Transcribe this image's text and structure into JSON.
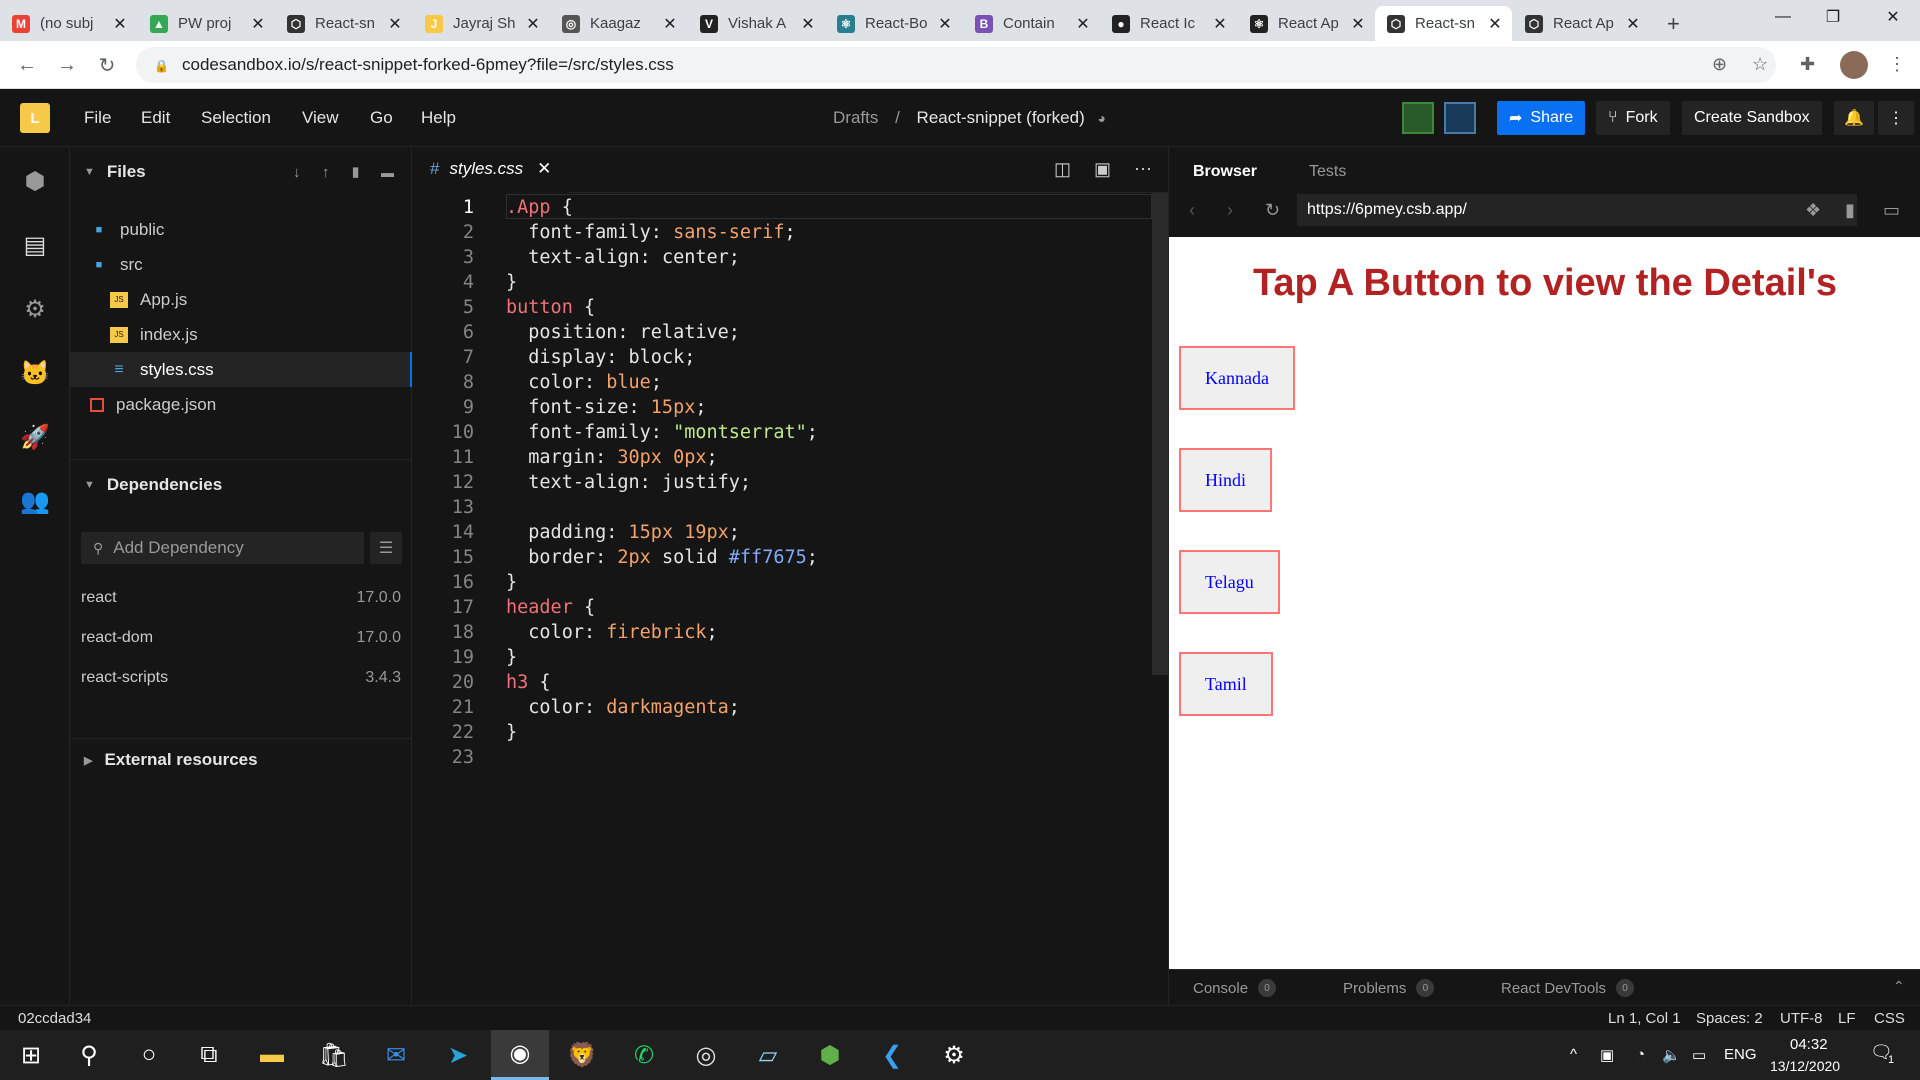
{
  "browser": {
    "tabs": [
      {
        "title": "(no subj",
        "icon": "gmail-icon",
        "color": "#ea4335",
        "glyph": "M"
      },
      {
        "title": "PW proj",
        "icon": "drive-icon",
        "color": "#34a853",
        "glyph": "▲"
      },
      {
        "title": "React-sn",
        "icon": "codesandbox-icon",
        "color": "#333333",
        "glyph": "⬡"
      },
      {
        "title": "Jayraj Sh",
        "icon": "j-icon",
        "color": "#f7c948",
        "glyph": "J"
      },
      {
        "title": "Kaagaz",
        "icon": "kaagaz-icon",
        "color": "#555555",
        "glyph": "◎"
      },
      {
        "title": "Vishak A",
        "icon": "v-icon",
        "color": "#222222",
        "glyph": "V"
      },
      {
        "title": "React-Bo",
        "icon": "react-bootstrap-icon",
        "color": "#2a7f8f",
        "glyph": "⚛"
      },
      {
        "title": "Contain",
        "icon": "bootstrap-icon",
        "color": "#7952b3",
        "glyph": "B"
      },
      {
        "title": "React Ic",
        "icon": "github-icon",
        "color": "#222222",
        "glyph": "●"
      },
      {
        "title": "React Ap",
        "icon": "react-icon",
        "color": "#222222",
        "glyph": "⚛"
      },
      {
        "title": "React-sn",
        "icon": "codesandbox-icon",
        "color": "#333333",
        "glyph": "⬡"
      },
      {
        "title": "React Ap",
        "icon": "codesandbox-icon",
        "color": "#333333",
        "glyph": "⬡"
      }
    ],
    "active_tab": 10,
    "url": "codesandbox.io/s/react-snippet-forked-6pmey?file=/src/styles.css"
  },
  "header": {
    "logo": "L",
    "menu": [
      "File",
      "Edit",
      "Selection",
      "View",
      "Go",
      "Help"
    ],
    "breadcrumb_folder": "Drafts",
    "breadcrumb_sep": "/",
    "sandbox_name": "React-snippet (forked)",
    "share_label": "Share",
    "fork_label": "Fork",
    "create_label": "Create Sandbox",
    "accent": "#0971f1"
  },
  "sidebar": {
    "files_title": "Files",
    "files": [
      {
        "name": "public",
        "type": "folder"
      },
      {
        "name": "src",
        "type": "folder-open"
      },
      {
        "name": "App.js",
        "type": "js"
      },
      {
        "name": "index.js",
        "type": "js"
      },
      {
        "name": "styles.css",
        "type": "css"
      },
      {
        "name": "package.json",
        "type": "json"
      }
    ],
    "deps_title": "Dependencies",
    "add_dep_placeholder": "Add Dependency",
    "dependencies": [
      {
        "name": "react",
        "version": "17.0.0"
      },
      {
        "name": "react-dom",
        "version": "17.0.0"
      },
      {
        "name": "react-scripts",
        "version": "3.4.3"
      }
    ],
    "external_title": "External resources"
  },
  "editor": {
    "tab_name": "styles.css",
    "tab_hash": "#",
    "code_lines": [
      [
        [
          "sel",
          ".App"
        ],
        [
          "p",
          " {"
        ]
      ],
      [
        [
          "p",
          "  font-family: "
        ],
        [
          "val",
          "sans-serif"
        ],
        [
          "p",
          ";"
        ]
      ],
      [
        [
          "p",
          "  text-align: "
        ],
        [
          "p",
          "center"
        ],
        [
          "p",
          ";"
        ]
      ],
      [
        [
          "p",
          "}"
        ]
      ],
      [
        [
          "sel",
          "button"
        ],
        [
          "p",
          " {"
        ]
      ],
      [
        [
          "p",
          "  position: "
        ],
        [
          "p",
          "relative"
        ],
        [
          "p",
          ";"
        ]
      ],
      [
        [
          "p",
          "  display: "
        ],
        [
          "p",
          "block"
        ],
        [
          "p",
          ";"
        ]
      ],
      [
        [
          "p",
          "  color: "
        ],
        [
          "val",
          "blue"
        ],
        [
          "p",
          ";"
        ]
      ],
      [
        [
          "p",
          "  font-size: "
        ],
        [
          "val",
          "15px"
        ],
        [
          "p",
          ";"
        ]
      ],
      [
        [
          "p",
          "  font-family: "
        ],
        [
          "str",
          "\"montserrat\""
        ],
        [
          "p",
          ";"
        ]
      ],
      [
        [
          "p",
          "  margin: "
        ],
        [
          "val",
          "30px 0px"
        ],
        [
          "p",
          ";"
        ]
      ],
      [
        [
          "p",
          "  text-align: "
        ],
        [
          "p",
          "justify"
        ],
        [
          "p",
          ";"
        ]
      ],
      [
        [
          "p",
          ""
        ]
      ],
      [
        [
          "p",
          "  padding: "
        ],
        [
          "val",
          "15px 19px"
        ],
        [
          "p",
          ";"
        ]
      ],
      [
        [
          "p",
          "  border: "
        ],
        [
          "val",
          "2px"
        ],
        [
          "p",
          " solid "
        ],
        [
          "hash",
          "#ff7675"
        ],
        [
          "p",
          ";"
        ]
      ],
      [
        [
          "p",
          "}"
        ]
      ],
      [
        [
          "sel",
          "header"
        ],
        [
          "p",
          " {"
        ]
      ],
      [
        [
          "p",
          "  color: "
        ],
        [
          "val",
          "firebrick"
        ],
        [
          "p",
          ";"
        ]
      ],
      [
        [
          "p",
          "}"
        ]
      ],
      [
        [
          "sel",
          "h3"
        ],
        [
          "p",
          " {"
        ]
      ],
      [
        [
          "p",
          "  color: "
        ],
        [
          "val",
          "darkmagenta"
        ],
        [
          "p",
          ";"
        ]
      ],
      [
        [
          "p",
          "}"
        ]
      ],
      [
        [
          "p",
          ""
        ]
      ]
    ]
  },
  "preview": {
    "tab_browser": "Browser",
    "tab_tests": "Tests",
    "url": "https://6pmey.csb.app/",
    "page_title": "Tap A Button to view the Detail's",
    "buttons": [
      "Kannada",
      "Hindi",
      "Telagu",
      "Tamil"
    ],
    "bottom_tabs": [
      {
        "label": "Console",
        "count": "0"
      },
      {
        "label": "Problems",
        "count": "0"
      },
      {
        "label": "React DevTools",
        "count": "0"
      }
    ]
  },
  "status": {
    "commit": "02ccdad34",
    "position": "Ln 1, Col 1",
    "spaces": "Spaces: 2",
    "encoding": "UTF-8",
    "eol": "LF",
    "language": "CSS"
  },
  "taskbar": {
    "lang": "ENG",
    "time": "04:32",
    "date": "13/12/2020",
    "notification_count": "1"
  }
}
